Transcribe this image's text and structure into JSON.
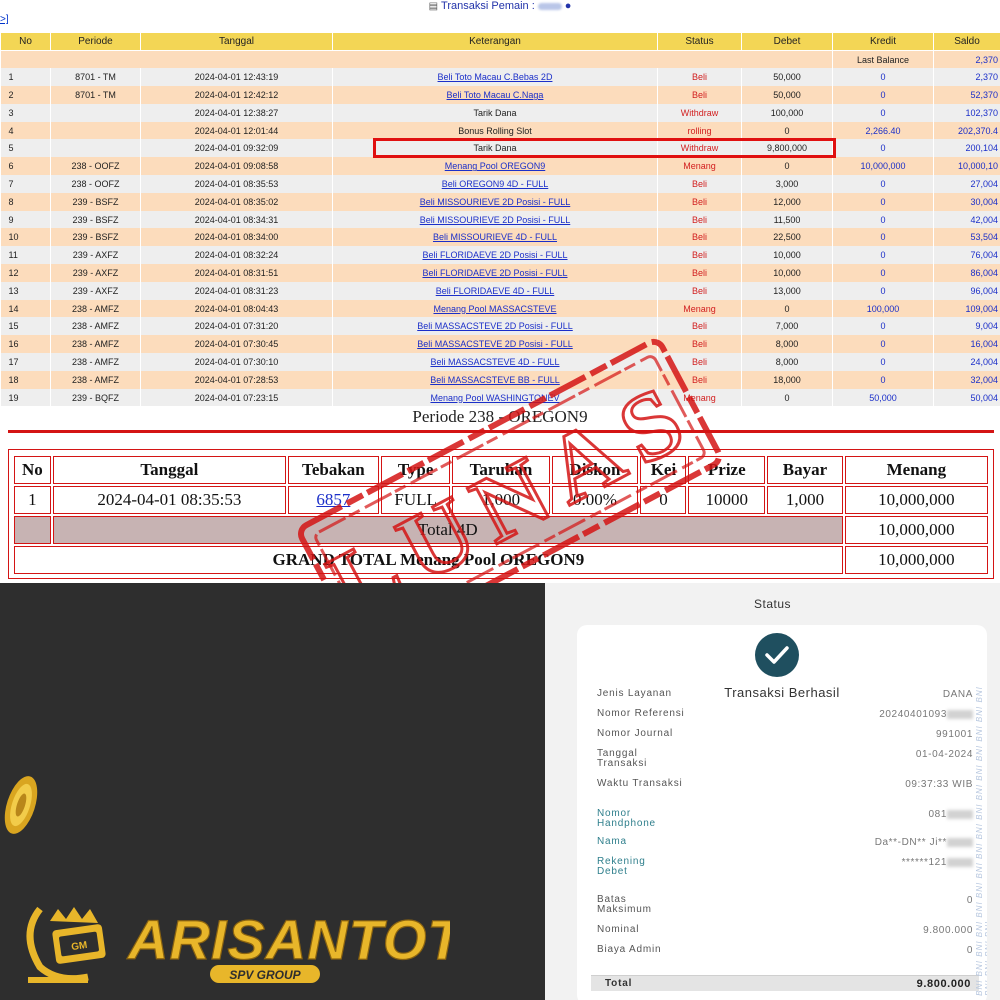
{
  "header": {
    "title_prefix": "Transaksi",
    "title_label": "Pemain :",
    "back_link": ">]"
  },
  "transactions": {
    "columns": [
      "No",
      "Periode",
      "Tanggal",
      "Keterangan",
      "Status",
      "Debet",
      "Kredit",
      "Saldo"
    ],
    "last_balance_label": "Last Balance",
    "last_balance_value": "2,370",
    "rows": [
      {
        "no": "1",
        "periode": "8701 - TM",
        "tanggal": "2024-04-01 12:43:19",
        "keterangan": "Beli Toto Macau C.Bebas 2D",
        "link": true,
        "status": "Beli",
        "debet": "50,000",
        "kredit": "0",
        "saldo": "2,370"
      },
      {
        "no": "2",
        "periode": "8701 - TM",
        "tanggal": "2024-04-01 12:42:12",
        "keterangan": "Beli Toto Macau C.Naga",
        "link": true,
        "status": "Beli",
        "debet": "50,000",
        "kredit": "0",
        "saldo": "52,370"
      },
      {
        "no": "3",
        "periode": "",
        "tanggal": "2024-04-01 12:38:27",
        "keterangan": "Tarik Dana",
        "link": false,
        "status": "Withdraw",
        "debet": "100,000",
        "kredit": "0",
        "saldo": "102,370"
      },
      {
        "no": "4",
        "periode": "",
        "tanggal": "2024-04-01 12:01:44",
        "keterangan": "Bonus Rolling Slot",
        "link": false,
        "status": "rolling",
        "debet": "0",
        "kredit": "2,266.40",
        "saldo": "202,370.4"
      },
      {
        "no": "5",
        "periode": "",
        "tanggal": "2024-04-01 09:32:09",
        "keterangan": "Tarik Dana",
        "link": false,
        "status": "Withdraw",
        "debet": "9,800,000",
        "kredit": "0",
        "saldo": "200,104"
      },
      {
        "no": "6",
        "periode": "238 - OOFZ",
        "tanggal": "2024-04-01 09:08:58",
        "keterangan": "Menang Pool OREGON9",
        "link": true,
        "status": "Menang",
        "debet": "0",
        "kredit": "10,000,000",
        "saldo": "10,000,10"
      },
      {
        "no": "7",
        "periode": "238 - OOFZ",
        "tanggal": "2024-04-01 08:35:53",
        "keterangan": "Beli OREGON9 4D - FULL",
        "link": true,
        "status": "Beli",
        "debet": "3,000",
        "kredit": "0",
        "saldo": "27,004"
      },
      {
        "no": "8",
        "periode": "239 - BSFZ",
        "tanggal": "2024-04-01 08:35:02",
        "keterangan": "Beli MISSOURIEVE 2D Posisi - FULL",
        "link": true,
        "status": "Beli",
        "debet": "12,000",
        "kredit": "0",
        "saldo": "30,004"
      },
      {
        "no": "9",
        "periode": "239 - BSFZ",
        "tanggal": "2024-04-01 08:34:31",
        "keterangan": "Beli MISSOURIEVE 2D Posisi - FULL",
        "link": true,
        "status": "Beli",
        "debet": "11,500",
        "kredit": "0",
        "saldo": "42,004"
      },
      {
        "no": "10",
        "periode": "239 - BSFZ",
        "tanggal": "2024-04-01 08:34:00",
        "keterangan": "Beli MISSOURIEVE 4D - FULL",
        "link": true,
        "status": "Beli",
        "debet": "22,500",
        "kredit": "0",
        "saldo": "53,504"
      },
      {
        "no": "11",
        "periode": "239 - AXFZ",
        "tanggal": "2024-04-01 08:32:24",
        "keterangan": "Beli FLORIDAEVE 2D Posisi - FULL",
        "link": true,
        "status": "Beli",
        "debet": "10,000",
        "kredit": "0",
        "saldo": "76,004"
      },
      {
        "no": "12",
        "periode": "239 - AXFZ",
        "tanggal": "2024-04-01 08:31:51",
        "keterangan": "Beli FLORIDAEVE 2D Posisi - FULL",
        "link": true,
        "status": "Beli",
        "debet": "10,000",
        "kredit": "0",
        "saldo": "86,004"
      },
      {
        "no": "13",
        "periode": "239 - AXFZ",
        "tanggal": "2024-04-01 08:31:23",
        "keterangan": "Beli FLORIDAEVE 4D - FULL",
        "link": true,
        "status": "Beli",
        "debet": "13,000",
        "kredit": "0",
        "saldo": "96,004"
      },
      {
        "no": "14",
        "periode": "238 - AMFZ",
        "tanggal": "2024-04-01 08:04:43",
        "keterangan": "Menang Pool MASSACSTEVE",
        "link": true,
        "status": "Menang",
        "debet": "0",
        "kredit": "100,000",
        "saldo": "109,004"
      },
      {
        "no": "15",
        "periode": "238 - AMFZ",
        "tanggal": "2024-04-01 07:31:20",
        "keterangan": "Beli MASSACSTEVE 2D Posisi - FULL",
        "link": true,
        "status": "Beli",
        "debet": "7,000",
        "kredit": "0",
        "saldo": "9,004"
      },
      {
        "no": "16",
        "periode": "238 - AMFZ",
        "tanggal": "2024-04-01 07:30:45",
        "keterangan": "Beli MASSACSTEVE 2D Posisi - FULL",
        "link": true,
        "status": "Beli",
        "debet": "8,000",
        "kredit": "0",
        "saldo": "16,004"
      },
      {
        "no": "17",
        "periode": "238 - AMFZ",
        "tanggal": "2024-04-01 07:30:10",
        "keterangan": "Beli MASSACSTEVE 4D - FULL",
        "link": true,
        "status": "Beli",
        "debet": "8,000",
        "kredit": "0",
        "saldo": "24,004"
      },
      {
        "no": "18",
        "periode": "238 - AMFZ",
        "tanggal": "2024-04-01 07:28:53",
        "keterangan": "Beli MASSACSTEVE BB - FULL",
        "link": true,
        "status": "Beli",
        "debet": "18,000",
        "kredit": "0",
        "saldo": "32,004"
      },
      {
        "no": "19",
        "periode": "239 - BQFZ",
        "tanggal": "2024-04-01 07:23:15",
        "keterangan": "Menang Pool WASHINGTONEV",
        "link": true,
        "status": "Menang",
        "debet": "0",
        "kredit": "50,000",
        "saldo": "50,004"
      }
    ]
  },
  "periode_title": "Periode 238 - OREGON9",
  "prize_table": {
    "columns": [
      "No",
      "Tanggal",
      "Tebakan",
      "Type",
      "Taruhan",
      "Diskon",
      "Kei",
      "Prize",
      "Bayar",
      "Menang"
    ],
    "row": {
      "no": "1",
      "tanggal": "2024-04-01 08:35:53",
      "tebakan": "6857",
      "type": "FULL",
      "taruhan": "1,000",
      "diskon": "0.00%",
      "kei": "0",
      "prize": "10000",
      "bayar": "1,000",
      "menang": "10,000,000"
    },
    "total_label": "Total 4D",
    "total_value": "10,000,000",
    "grand_label": "GRAND TOTAL  Menang Pool OREGON9",
    "grand_value": "10,000,000"
  },
  "stamp_text": "LUNAS",
  "brand": {
    "logo_text": "ARISANTOTO",
    "sub_text": "SPV GROUP",
    "colors": {
      "gold": "#e8b62a",
      "dark": "#2e2e2e"
    }
  },
  "receipt": {
    "screen_title": "Status",
    "success_title": "Transaksi Berhasil",
    "fields": [
      {
        "label": "Jenis Layanan",
        "value": "DANA",
        "teal": false
      },
      {
        "label": "Nomor Referensi",
        "value": "20240401093",
        "teal": false,
        "blurred": true
      },
      {
        "label": "Nomor Journal",
        "value": "991001",
        "teal": false
      },
      {
        "label": "Tanggal\nTransaksi",
        "value": "01-04-2024",
        "teal": false
      },
      {
        "label": "Waktu Transaksi",
        "value": "09:37:33 WIB",
        "teal": false
      },
      {
        "label": "Nomor\nHandphone",
        "value": "081",
        "teal": true,
        "blurred": true
      },
      {
        "label": "Nama",
        "value": "Da**-DN** Ji**",
        "teal": true,
        "blurred": true
      },
      {
        "label": "Rekening\nDebet",
        "value": "******121",
        "teal": true,
        "blurred": true
      },
      {
        "label": "Batas\nMaksimum",
        "value": "0",
        "teal": false
      },
      {
        "label": "Nominal",
        "value": "9.800.000",
        "teal": false
      },
      {
        "label": "Biaya Admin",
        "value": "0",
        "teal": false
      }
    ],
    "total_label": "Total",
    "total_value": "9.800.000",
    "watermark": "BNI BNI BNI BNI BNI BNI BNI BNI BNI BNI BNI BNI BNI BNI BNI BNI BNI BNI BNI BNI BNI BNI BNI BNI"
  },
  "colors": {
    "header_yellow": "#f3d655",
    "row_peach": "#fcdcbc",
    "row_grey": "#eeeeee",
    "link_blue": "#1b2fc9",
    "status_red": "#d22020",
    "stamp_red": "#d41414",
    "teal": "#1f4f5f"
  }
}
